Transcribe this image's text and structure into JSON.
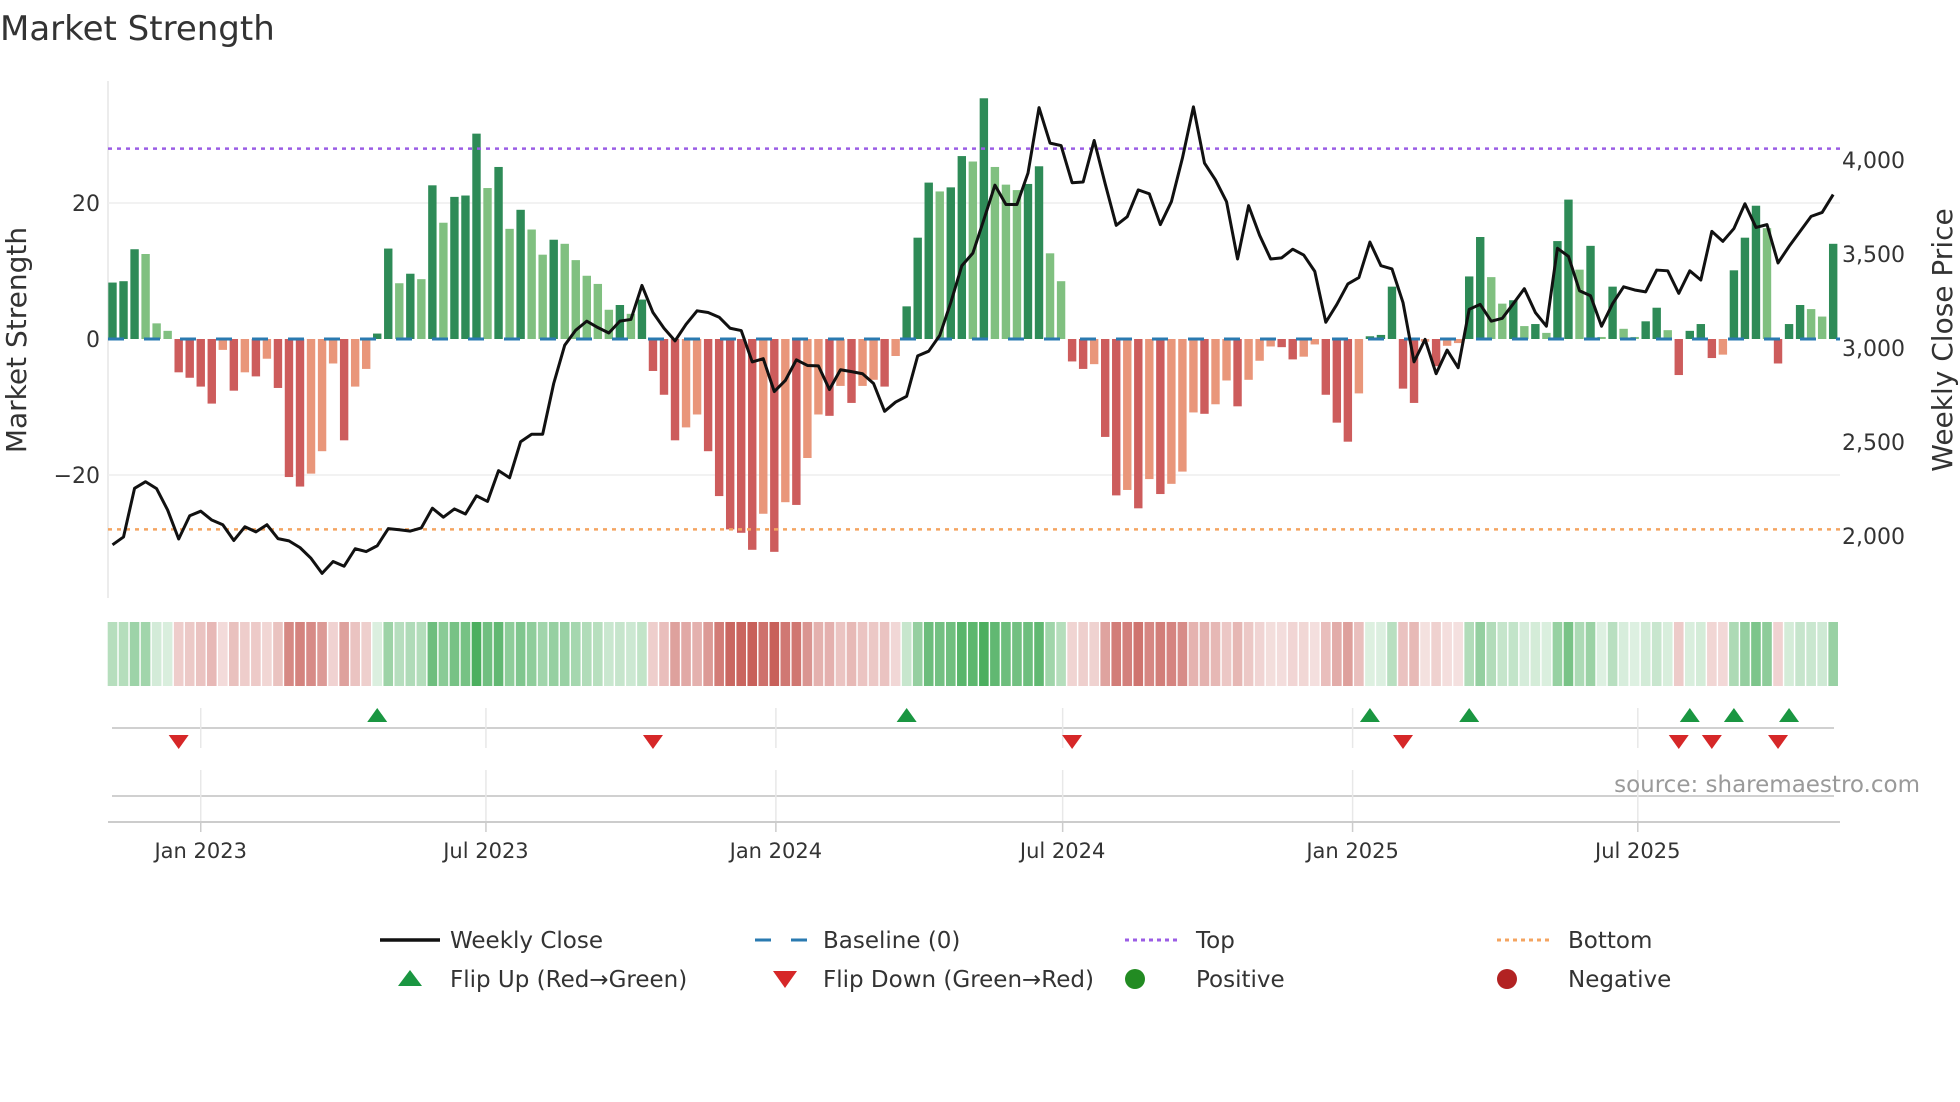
{
  "chart_data": {
    "type": "bar",
    "title": "Market Strength",
    "ylabel_left": "Market Strength",
    "ylabel_right": "Weekly Close Price",
    "source": "source: sharemaestro.com",
    "start_week": "2022-11-06",
    "interval_days": 7,
    "ylim_left": [
      -31.5,
      37.5
    ],
    "left_ticks": [
      {
        "value": 20,
        "label": "20"
      },
      {
        "value": 0,
        "label": "0"
      },
      {
        "value": -20,
        "label": "−20"
      }
    ],
    "right_ticks": [
      {
        "value": 4000,
        "label": "4,000"
      },
      {
        "value": 3500,
        "label": "3,500"
      },
      {
        "value": 3000,
        "label": "3,000"
      },
      {
        "value": 2500,
        "label": "2,500"
      },
      {
        "value": 2000,
        "label": "2,000"
      }
    ],
    "x_ticks": [
      {
        "date": "2023-01-01",
        "label": "Jan 2023"
      },
      {
        "date": "2023-07-01",
        "label": "Jul 2023"
      },
      {
        "date": "2024-01-01",
        "label": "Jan 2024"
      },
      {
        "date": "2024-07-01",
        "label": "Jul 2024"
      },
      {
        "date": "2025-01-01",
        "label": "Jan 2025"
      },
      {
        "date": "2025-07-01",
        "label": "Jul 2025"
      }
    ],
    "top_level": 28,
    "bottom_level": -28,
    "baseline": 0,
    "strength": [
      8.3,
      8.5,
      13.2,
      12.5,
      2.3,
      1.2,
      -4.9,
      -5.7,
      -7.0,
      -9.5,
      -1.6,
      -7.6,
      -4.9,
      -5.5,
      -2.9,
      -7.2,
      -20.3,
      -21.7,
      -19.8,
      -16.5,
      -3.6,
      -14.9,
      -7.0,
      -4.4,
      0.8,
      13.3,
      8.2,
      9.6,
      8.8,
      22.6,
      17.1,
      20.9,
      21.1,
      30.2,
      22.2,
      25.3,
      16.2,
      19.0,
      16.1,
      12.4,
      14.6,
      14.0,
      11.6,
      9.3,
      8.1,
      4.3,
      5.0,
      3.7,
      5.8,
      -4.7,
      -8.2,
      -14.9,
      -13.0,
      -11.1,
      -16.5,
      -23.1,
      -28.0,
      -28.5,
      -31.0,
      -25.7,
      -31.3,
      -24.0,
      -24.4,
      -17.5,
      -11.1,
      -11.3,
      -6.9,
      -9.4,
      -6.9,
      -6.0,
      -7.0,
      -2.5,
      4.8,
      14.9,
      23.0,
      21.7,
      22.3,
      26.9,
      26.1,
      35.4,
      25.3,
      22.7,
      21.9,
      22.8,
      25.4,
      12.6,
      8.5,
      -3.3,
      -4.4,
      -3.7,
      -14.4,
      -23.0,
      -22.2,
      -24.9,
      -20.6,
      -22.8,
      -21.3,
      -19.5,
      -10.8,
      -11.0,
      -9.6,
      -6.1,
      -9.9,
      -6.0,
      -3.2,
      -1.1,
      -1.2,
      -3.0,
      -2.6,
      -0.8,
      -8.2,
      -12.3,
      -15.1,
      -8.0,
      0.4,
      0.6,
      7.7,
      -7.3,
      -9.4,
      -0.4,
      -4.0,
      -1.0,
      -0.6,
      9.2,
      15.0,
      9.1,
      5.2,
      5.7,
      1.9,
      2.2,
      0.9,
      14.4,
      20.5,
      10.2,
      13.7,
      0.3,
      7.7,
      1.5,
      0.3,
      2.6,
      4.6,
      1.3,
      -5.3,
      1.2,
      2.2,
      -2.8,
      -2.3,
      10.1,
      14.9,
      19.6,
      16.3,
      -3.6,
      2.2,
      5.0,
      4.4,
      3.3,
      14.0
    ],
    "weekly_close": [
      1952,
      1994,
      2253,
      2288,
      2251,
      2137,
      1983,
      2107,
      2131,
      2084,
      2059,
      1975,
      2048,
      2021,
      2059,
      1985,
      1973,
      1937,
      1880,
      1800,
      1863,
      1838,
      1931,
      1916,
      1947,
      2038,
      2032,
      2025,
      2042,
      2147,
      2099,
      2143,
      2116,
      2213,
      2183,
      2347,
      2309,
      2501,
      2541,
      2541,
      2811,
      3015,
      3095,
      3143,
      3109,
      3080,
      3143,
      3152,
      3333,
      3189,
      3105,
      3038,
      3126,
      3198,
      3189,
      3164,
      3105,
      3093,
      2926,
      2943,
      2768,
      2827,
      2937,
      2907,
      2905,
      2779,
      2884,
      2874,
      2863,
      2811,
      2663,
      2712,
      2743,
      2958,
      2983,
      3067,
      3242,
      3438,
      3505,
      3684,
      3867,
      3764,
      3764,
      3931,
      4280,
      4091,
      4078,
      3880,
      3884,
      4105,
      3874,
      3653,
      3699,
      3842,
      3821,
      3657,
      3779,
      4011,
      4284,
      3985,
      3895,
      3779,
      3474,
      3758,
      3600,
      3474,
      3480,
      3526,
      3495,
      3408,
      3137,
      3232,
      3341,
      3375,
      3564,
      3438,
      3421,
      3242,
      2926,
      3046,
      2863,
      2989,
      2895,
      3206,
      3232,
      3143,
      3158,
      3236,
      3316,
      3189,
      3116,
      3531,
      3488,
      3305,
      3278,
      3116,
      3236,
      3326,
      3309,
      3299,
      3415,
      3411,
      3291,
      3411,
      3362,
      3621,
      3568,
      3636,
      3768,
      3642,
      3657,
      3453,
      3541,
      3621,
      3701,
      3722,
      3817
    ],
    "colors": {
      "pos_strong": "#2e8b57",
      "pos_weak": "#80c080",
      "neg_strong": "#cd5c5c",
      "neg_weak": "#e9967a",
      "heat_pos": "#4caf5f",
      "heat_neg": "#c8605a",
      "line": "#111111",
      "baseline": "#2a7ab0",
      "top": "#9b5de5",
      "bottom": "#f4a460",
      "flip_up": "#1a9641",
      "flip_down": "#d62728",
      "positive": "#228b22",
      "negative": "#b22222"
    },
    "legend": [
      {
        "key": "line",
        "label": "Weekly Close"
      },
      {
        "key": "baseline",
        "label": "Baseline (0)"
      },
      {
        "key": "top",
        "label": "Top"
      },
      {
        "key": "bottom",
        "label": "Bottom"
      },
      {
        "key": "flip_up",
        "label": "Flip Up (Red→Green)"
      },
      {
        "key": "flip_down",
        "label": "Flip Down (Green→Red)"
      },
      {
        "key": "positive",
        "label": "Positive"
      },
      {
        "key": "negative",
        "label": "Negative"
      }
    ]
  }
}
